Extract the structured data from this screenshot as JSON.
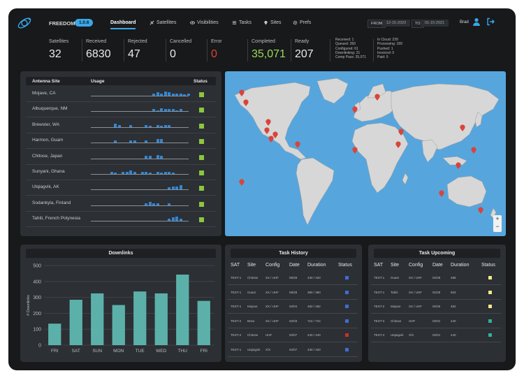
{
  "header": {
    "brand": "FREEDOM",
    "version": "1.0.6",
    "nav": [
      {
        "label": "Dashboard",
        "icon": "none"
      },
      {
        "label": "Satellites",
        "icon": "satellite-icon"
      },
      {
        "label": "Visibilities",
        "icon": "eye-icon"
      },
      {
        "label": "Tasks",
        "icon": "list-icon"
      },
      {
        "label": "Sites",
        "icon": "pin-icon"
      },
      {
        "label": "Prefs",
        "icon": "gear-icon"
      }
    ],
    "from_label": "FROM",
    "from_value": "12-15-2020",
    "to_label": "TO",
    "to_value": "01-15-2021",
    "user": "Brad"
  },
  "stats": [
    {
      "label": "Satellites",
      "value": "32"
    },
    {
      "label": "Received",
      "value": "6830"
    },
    {
      "label": "Rejected",
      "value": "47"
    },
    {
      "label": "Cancelled",
      "value": "0"
    },
    {
      "label": "Error",
      "value": "0"
    },
    {
      "label": "Completed",
      "value": "35,071"
    },
    {
      "label": "Ready",
      "value": "207"
    }
  ],
  "mini_stats_left": [
    "Received: 1",
    "Queued: 283",
    "Configured: 61",
    "Downlinking: 21",
    "Comp Pass: 35,071"
  ],
  "mini_stats_right": [
    "In Cloud: 239",
    "Processing: 189",
    "Pushed: 1",
    "Invoiced: 0",
    "Paid: 0"
  ],
  "antenna": {
    "headers": {
      "site": "Antenna Site",
      "usage": "Usage",
      "status": "Status"
    },
    "status_color": "#8cc63f",
    "bar_color": "#2f86d6",
    "rows": [
      {
        "site": "Mojave, CA",
        "usage": [
          0,
          0,
          0,
          0,
          0,
          0,
          0,
          0,
          0,
          0,
          0,
          0,
          0,
          0,
          0,
          0,
          2,
          3,
          2,
          4,
          3,
          2,
          2,
          2,
          1,
          2
        ]
      },
      {
        "site": "Albuquerque, NM",
        "usage": [
          0,
          0,
          0,
          0,
          0,
          0,
          0,
          0,
          0,
          0,
          0,
          0,
          0,
          0,
          0,
          0,
          2,
          1,
          3,
          2,
          2,
          2,
          1,
          2,
          0,
          0
        ]
      },
      {
        "site": "Brewster, WA",
        "usage": [
          0,
          0,
          0,
          0,
          0,
          0,
          3,
          2,
          0,
          0,
          2,
          0,
          0,
          0,
          2,
          1,
          0,
          2,
          1,
          2,
          2,
          0,
          0,
          0,
          0,
          0
        ]
      },
      {
        "site": "Harmon, Guam",
        "usage": [
          0,
          0,
          0,
          0,
          0,
          0,
          2,
          0,
          0,
          0,
          2,
          2,
          0,
          0,
          2,
          0,
          0,
          3,
          3,
          0,
          0,
          0,
          0,
          0,
          0,
          0
        ]
      },
      {
        "site": "Chitose, Japan",
        "usage": [
          0,
          0,
          0,
          0,
          0,
          0,
          0,
          0,
          0,
          0,
          0,
          0,
          0,
          0,
          2,
          2,
          0,
          3,
          2,
          0,
          0,
          0,
          0,
          0,
          0,
          0
        ]
      },
      {
        "site": "Sunyani, Ghana",
        "usage": [
          0,
          0,
          0,
          0,
          0,
          2,
          1,
          0,
          2,
          2,
          3,
          2,
          0,
          2,
          2,
          1,
          0,
          2,
          1,
          2,
          2,
          1,
          0,
          0,
          0,
          0
        ]
      },
      {
        "site": "Utqiagvik, AK",
        "usage": [
          0,
          0,
          0,
          0,
          0,
          0,
          0,
          0,
          0,
          0,
          0,
          0,
          0,
          0,
          0,
          0,
          0,
          0,
          0,
          0,
          2,
          3,
          3,
          4,
          0,
          0
        ]
      },
      {
        "site": "Sodankyla, Finland",
        "usage": [
          0,
          0,
          0,
          0,
          0,
          0,
          0,
          0,
          0,
          0,
          0,
          0,
          0,
          0,
          2,
          3,
          2,
          2,
          0,
          0,
          2,
          0,
          0,
          0,
          0,
          0
        ]
      },
      {
        "site": "Tahiti, French Polynesia",
        "usage": [
          0,
          0,
          0,
          0,
          0,
          0,
          0,
          0,
          0,
          0,
          0,
          0,
          0,
          0,
          0,
          0,
          0,
          0,
          0,
          0,
          2,
          3,
          4,
          2,
          0,
          0
        ]
      }
    ]
  },
  "map": {
    "zoom_in": "+",
    "zoom_out": "−",
    "ocean_color": "#56a6dd",
    "land_color": "#d7d7d7",
    "marker_color": "#d9443a"
  },
  "downlinks": {
    "title": "Downlinks",
    "chart_data": {
      "type": "bar",
      "categories": [
        "FRI",
        "SAT",
        "SUN",
        "MON",
        "TUE",
        "WED",
        "THU",
        "FRI"
      ],
      "values": [
        135,
        285,
        325,
        252,
        337,
        325,
        443,
        278
      ],
      "ylabel": "# Downlinks",
      "ylim": [
        0,
        500
      ],
      "yticks": [
        "0",
        "100",
        "200",
        "300",
        "400",
        "500"
      ],
      "grid": true,
      "bar_color": "#5cb0aa"
    }
  },
  "task_history": {
    "title": "Task History",
    "headers": [
      "SAT",
      "Site",
      "Config",
      "Date",
      "Duration",
      "Status"
    ],
    "rows": [
      {
        "sat": "TEST-1",
        "site": "Chitose",
        "config": "SX / UHF",
        "date": "08/28",
        "duration": "430 / 430",
        "status": "#3d6dd6"
      },
      {
        "sat": "TEST-1",
        "site": "Guam",
        "config": "SX / UHF",
        "date": "08/28",
        "duration": "380 / 380",
        "status": "#3d6dd6"
      },
      {
        "sat": "TEST-1",
        "site": "Mojave",
        "config": "SX / UHF",
        "date": "02/04",
        "duration": "482 / 482",
        "status": "#3d6dd6"
      },
      {
        "sat": "TEST-2",
        "site": "Brew",
        "config": "SX / UHF",
        "date": "02/03",
        "duration": "724 / 724",
        "status": "#3d6dd6"
      },
      {
        "sat": "TEST-2",
        "site": "Chitose",
        "config": "UHF",
        "date": "02/07",
        "duration": "440 / 440",
        "status": "#c9302c"
      },
      {
        "sat": "TEST-1",
        "site": "Utqiagvik",
        "config": "X/X",
        "date": "02/07",
        "duration": "430 / 430",
        "status": "#3d6dd6"
      }
    ]
  },
  "task_upcoming": {
    "title": "Task Upcoming",
    "headers": [
      "SAT",
      "Site",
      "Config",
      "Date",
      "Duration",
      "Status"
    ],
    "rows": [
      {
        "sat": "TEST-1",
        "site": "Guam",
        "config": "SX / UHF",
        "date": "02/28",
        "duration": "488",
        "status": "#f2e88c"
      },
      {
        "sat": "TEST-1",
        "site": "Tahiti",
        "config": "SX / UHF",
        "date": "02/28",
        "duration": "503",
        "status": "#f2e88c"
      },
      {
        "sat": "TEST-2",
        "site": "Mojave",
        "config": "SX / UHF",
        "date": "02/26",
        "duration": "482",
        "status": "#f2e88c"
      },
      {
        "sat": "TEST-3",
        "site": "Chitose",
        "config": "UHF",
        "date": "02/01",
        "duration": "440",
        "status": "#2ab39b"
      },
      {
        "sat": "TEST-4",
        "site": "Utqiagvik",
        "config": "X/X",
        "date": "02/01",
        "duration": "440",
        "status": "#2ab39b"
      }
    ]
  }
}
